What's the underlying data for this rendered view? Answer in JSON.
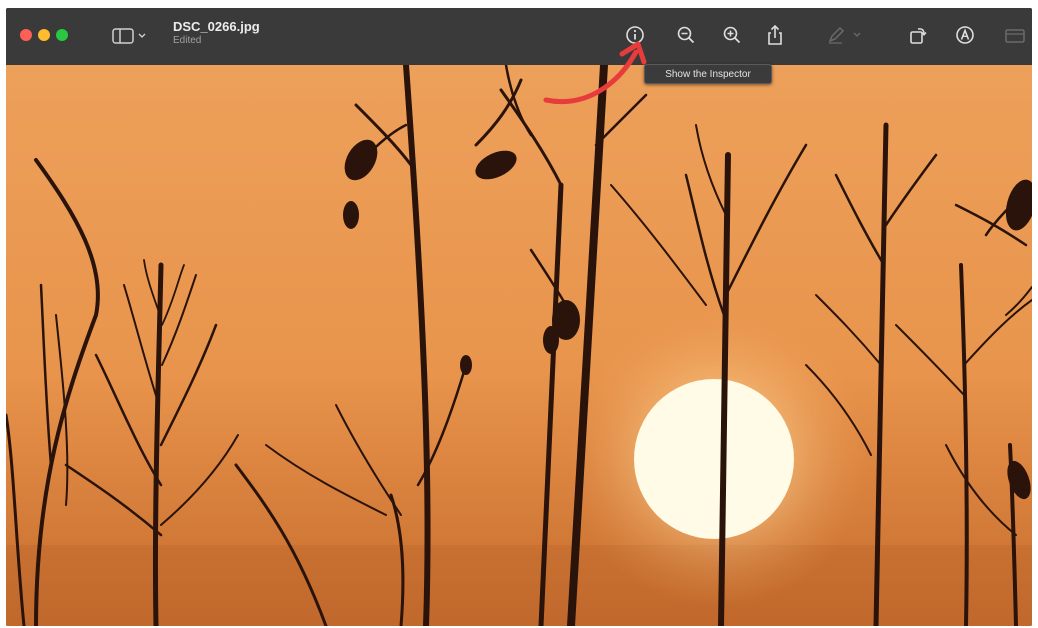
{
  "window": {
    "title": "DSC_0266.jpg",
    "subtitle": "Edited"
  },
  "toolbar": {
    "buttons": [
      {
        "name": "info-icon"
      },
      {
        "name": "zoom-out-icon"
      },
      {
        "name": "zoom-in-icon"
      },
      {
        "name": "share-icon"
      },
      {
        "name": "markup-icon"
      },
      {
        "name": "rotate-icon"
      },
      {
        "name": "annotate-icon"
      },
      {
        "name": "toolbox-icon"
      }
    ]
  },
  "tooltip": {
    "text": "Show the Inspector"
  },
  "image": {
    "subject": "sunset-silhouette-photo"
  },
  "colors": {
    "titlebar": "#3a3a3a",
    "sky_top": "#e99a52",
    "sky_bottom": "#c76a28",
    "sun": "#fffbe8",
    "annotation_arrow": "#e83c3c"
  }
}
